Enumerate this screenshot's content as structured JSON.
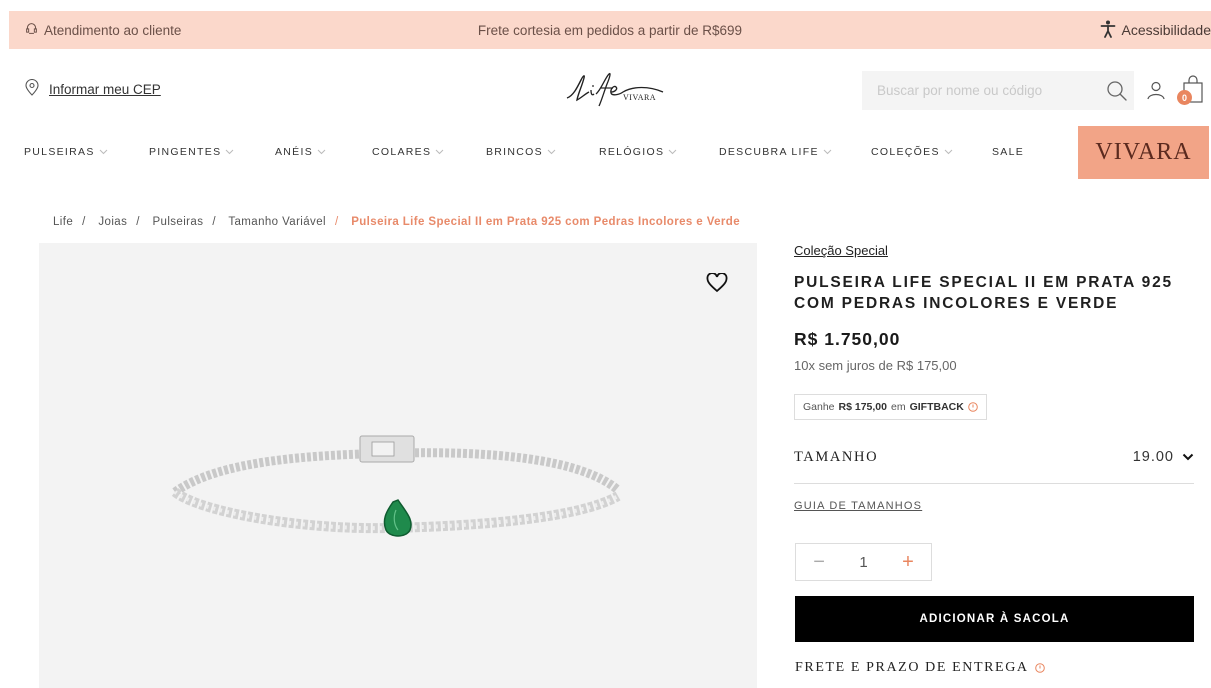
{
  "topbar": {
    "customer_service": "Atendimento ao cliente",
    "shipping_promo": "Frete cortesia em pedidos a partir de R$699",
    "accessibility": "Acessibilidade"
  },
  "header": {
    "cep_label": "Informar meu CEP",
    "search_placeholder": "Buscar por nome ou código",
    "cart_count": "0"
  },
  "nav": {
    "items": [
      {
        "label": "PULSEIRAS"
      },
      {
        "label": "PINGENTES"
      },
      {
        "label": "ANÉIS"
      },
      {
        "label": "COLARES"
      },
      {
        "label": "BRINCOS"
      },
      {
        "label": "RELÓGIOS"
      },
      {
        "label": "DESCUBRA LIFE"
      },
      {
        "label": "COLEÇÕES"
      },
      {
        "label": "SALE"
      }
    ],
    "brand_button": "VIVARA"
  },
  "breadcrumb": {
    "items": [
      "Life",
      "Joias",
      "Pulseiras",
      "Tamanho Variável"
    ],
    "current": "Pulseira Life Special II em Prata 925 com Pedras Incolores e Verde"
  },
  "product": {
    "collection": "Coleção Special",
    "title": "PULSEIRA LIFE SPECIAL II EM PRATA 925 COM PEDRAS INCOLORES E VERDE",
    "price": "R$ 1.750,00",
    "installments": "10x sem juros de R$ 175,00",
    "giftback_prefix": "Ganhe",
    "giftback_amount": "R$ 175,00",
    "giftback_mid": "em",
    "giftback_label": "GIFTBACK",
    "size_label": "TAMANHO",
    "size_value": "19.00",
    "size_guide": "GUIA DE TAMANHOS",
    "quantity": "1",
    "add_to_bag": "ADICIONAR À SACOLA",
    "shipping_title": "FRETE E PRAZO DE ENTREGA"
  },
  "colors": {
    "topbar_bg": "#fbd8cb",
    "accent": "#e9865f",
    "brand_bg": "#f2a487",
    "button_bg": "#000000"
  }
}
